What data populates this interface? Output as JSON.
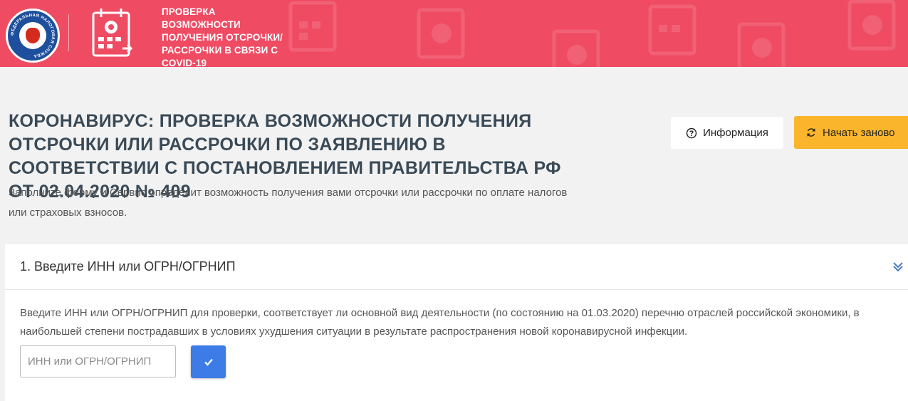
{
  "header": {
    "title": "ПРОВЕРКА ВОЗМОЖНОСТИ ПОЛУЧЕНИЯ ОТСРОЧКИ/ РАССРОЧКИ В СВЯЗИ С COVID-19",
    "background_color": "#ef4b63",
    "emblem_text": "ФЕДЕРАЛЬНАЯ НАЛОГОВАЯ СЛУЖБА"
  },
  "main": {
    "title": "КОРОНАВИРУС: ПРОВЕРКА ВОЗМОЖНОСТИ ПОЛУЧЕНИЯ ОТСРОЧКИ ИЛИ РАССРОЧКИ ПО ЗАЯВЛЕНИЮ В СООТВЕТСТВИИ С ПОСТАНОВЛЕНИЕМ ПРАВИТЕЛЬСТВА РФ ОТ 02.04.2020 № 409",
    "subtitle": "Заполните форму и Сервис определит возможность получения вами отсрочки или рассрочки по оплате налогов или страховых взносов."
  },
  "actions": {
    "info_label": "Информация",
    "restart_label": "Начать заново",
    "restart_color": "#fbb52c"
  },
  "step1": {
    "title": "1. Введите ИНН или ОГРН/ОГРНИП",
    "description": "Введите ИНН или ОГРН/ОГРНИП для проверки, соответствует ли основной вид деятельности (по состоянию на 01.03.2020) перечню отраслей российской экономики, в наибольшей степени пострадавших в условиях ухудшения ситуации в результате распространения новой коронавирусной инфекции.",
    "input_placeholder": "ИНН или ОГРН/ОГРНИП",
    "input_value": "",
    "submit_color": "#3d7be6"
  },
  "icons": {
    "info": "question-circle-icon",
    "restart": "refresh-icon",
    "expand": "chevron-down-icon",
    "submit": "checkmark-icon",
    "service": "calendar-virus-icon",
    "logo": "fns-emblem"
  }
}
